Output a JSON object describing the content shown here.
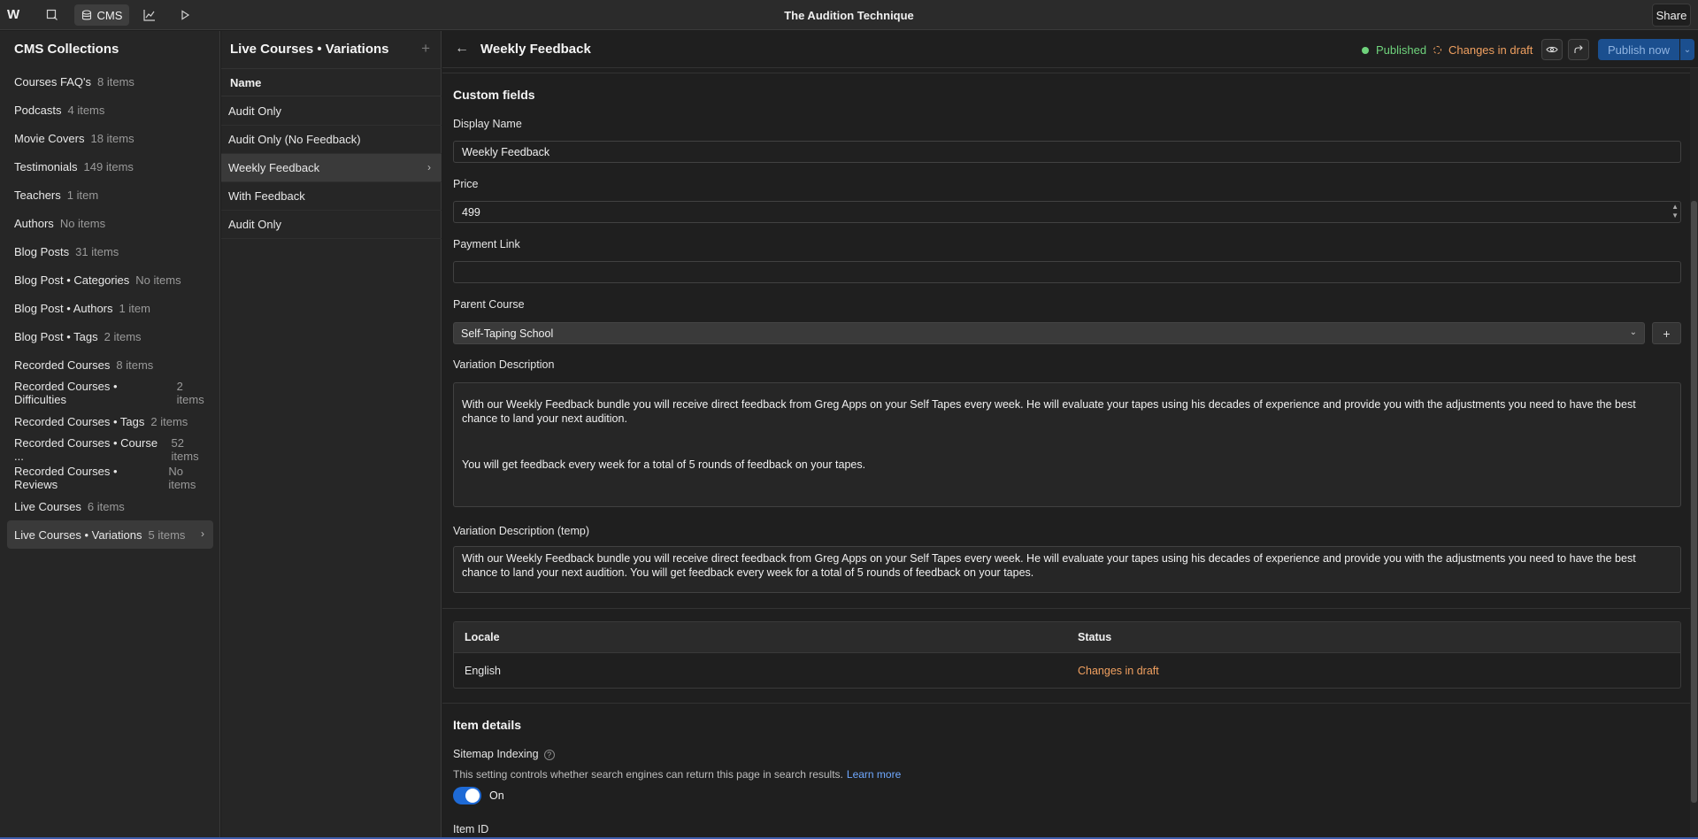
{
  "topbar": {
    "title": "The Audition Technique",
    "cms_label": "CMS",
    "share_label": "Share",
    "logo_text": "W"
  },
  "sidebar": {
    "heading": "CMS Collections",
    "items": [
      {
        "name": "Courses FAQ's",
        "count": "8 items"
      },
      {
        "name": "Podcasts",
        "count": "4 items"
      },
      {
        "name": "Movie Covers",
        "count": "18 items"
      },
      {
        "name": "Testimonials",
        "count": "149 items"
      },
      {
        "name": "Teachers",
        "count": "1 item"
      },
      {
        "name": "Authors",
        "count": "No items"
      },
      {
        "name": "Blog Posts",
        "count": "31 items"
      },
      {
        "name": "Blog Post • Categories",
        "count": "No items"
      },
      {
        "name": "Blog Post • Authors",
        "count": "1 item"
      },
      {
        "name": "Blog Post • Tags",
        "count": "2 items"
      },
      {
        "name": "Recorded Courses",
        "count": "8 items"
      },
      {
        "name": "Recorded Courses • Difficulties",
        "count": "2 items"
      },
      {
        "name": "Recorded Courses • Tags",
        "count": "2 items"
      },
      {
        "name": "Recorded Courses • Course ...",
        "count": "52 items"
      },
      {
        "name": "Recorded Courses • Reviews",
        "count": "No items"
      },
      {
        "name": "Live Courses",
        "count": "6 items"
      },
      {
        "name": "Live Courses • Variations",
        "count": "5 items"
      }
    ]
  },
  "middle": {
    "heading": "Live Courses • Variations",
    "column_header": "Name",
    "items": [
      "Audit Only",
      "Audit Only (No Feedback)",
      "Weekly Feedback",
      "With Feedback",
      "Audit Only"
    ]
  },
  "editor": {
    "title": "Weekly Feedback",
    "published_label": "Published",
    "draft_label": "Changes in draft",
    "publish_button": "Publish now",
    "custom_fields_heading": "Custom fields",
    "display_name_label": "Display Name",
    "display_name_value": "Weekly Feedback",
    "price_label": "Price",
    "price_value": "499",
    "payment_link_label": "Payment Link",
    "payment_link_value": "",
    "parent_course_label": "Parent Course",
    "parent_course_value": "Self-Taping School",
    "variation_description_label": "Variation Description",
    "variation_description_p1": "With our Weekly Feedback bundle you will receive direct feedback from Greg Apps on your Self Tapes every week. He will evaluate your tapes using his decades of experience and provide you with the adjustments you need to have the best chance to land your next audition.",
    "variation_description_p2": "You will get feedback every week for a total of 5 rounds of feedback on your tapes.",
    "variation_description_temp_label": "Variation Description (temp)",
    "variation_description_temp_value": "With our Weekly Feedback bundle you will receive direct feedback from Greg Apps on your Self Tapes every week. He will evaluate your tapes using his decades of experience and provide you with the adjustments you need to have the best chance to land your next audition.  You will get feedback every week for a total of 5 rounds of feedback on your tapes.",
    "locale_table": {
      "headers": [
        "Locale",
        "Status"
      ],
      "rows": [
        {
          "locale": "English",
          "status": "Changes in draft"
        }
      ]
    },
    "item_details_heading": "Item details",
    "sitemap_label": "Sitemap Indexing",
    "sitemap_help": "This setting controls whether search engines can return this page in search results.",
    "learn_more": "Learn more",
    "toggle_label": "On",
    "item_id_label": "Item ID"
  },
  "colors": {
    "accent_blue": "#1e6ad6",
    "published_green": "#6fd37c",
    "draft_orange": "#f0a060"
  }
}
